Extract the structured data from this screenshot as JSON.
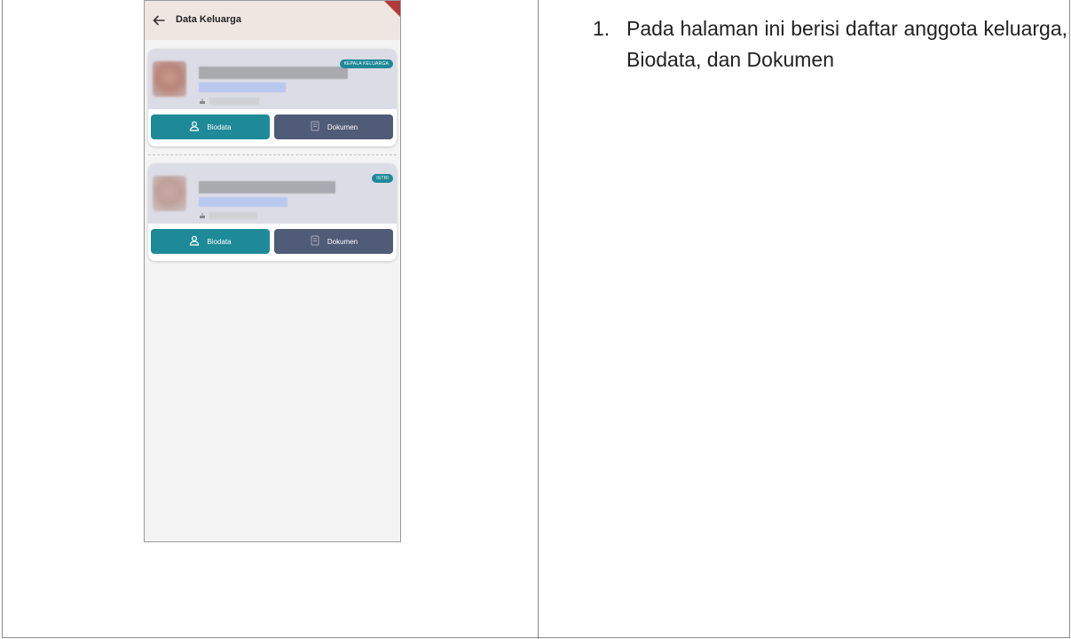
{
  "app": {
    "title": "Data Keluarga"
  },
  "members": [
    {
      "badge": "KEPALA KELUARGA",
      "buttons": {
        "biodata": "Biodata",
        "dokumen": "Dokumen"
      }
    },
    {
      "badge": "ISTRI",
      "buttons": {
        "biodata": "Biodata",
        "dokumen": "Dokumen"
      }
    }
  ],
  "instructions": [
    {
      "number": "1.",
      "text": "Pada halaman ini berisi daftar anggota keluarga, Biodata, dan Dokumen"
    }
  ],
  "colors": {
    "teal": "#1e8a98",
    "slate": "#505b78",
    "appbar": "#efe6e2",
    "ribbon": "#b23a3a"
  },
  "icons": [
    "back-arrow-icon",
    "person-icon",
    "document-icon",
    "cake-icon"
  ]
}
